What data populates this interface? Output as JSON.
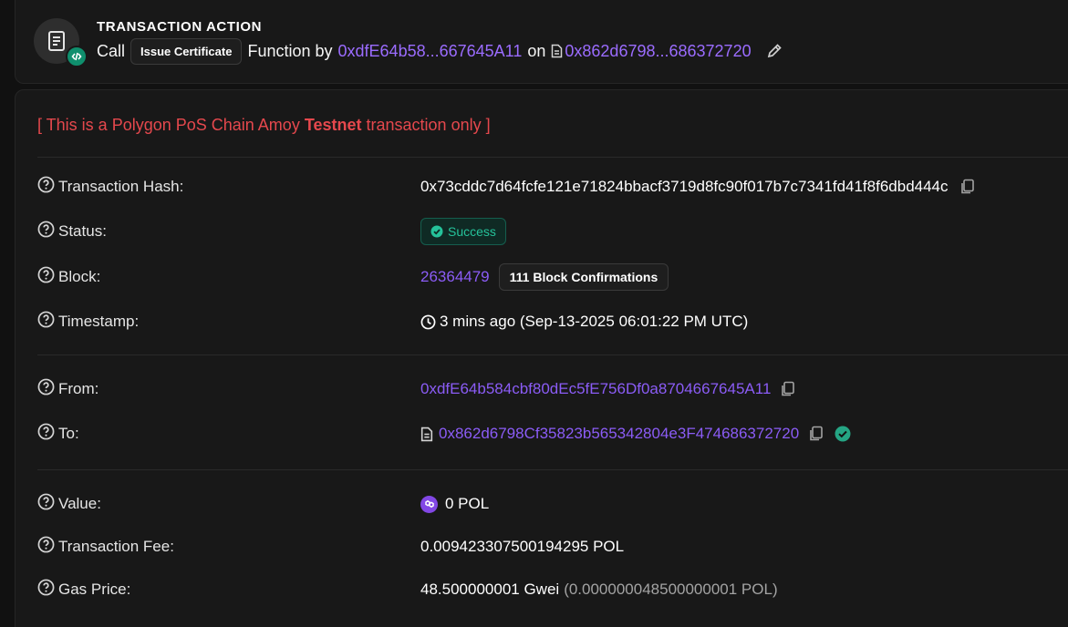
{
  "action": {
    "title": "TRANSACTION ACTION",
    "call": "Call",
    "method": "Issue Certificate",
    "function_by": "Function by",
    "from_short": "0xdfE64b58...667645A11",
    "on": "on",
    "contract_short": "0x862d6798...686372720"
  },
  "notice": {
    "prefix": "[ This is a Polygon PoS Chain Amoy ",
    "highlight": "Testnet",
    "suffix": " transaction only ]"
  },
  "rows": {
    "hash": {
      "label": "Transaction Hash:",
      "value": "0x73cddc7d64fcfe121e71824bbacf3719d8fc90f017b7c7341fd41f8f6dbd444c"
    },
    "status": {
      "label": "Status:",
      "value": "Success"
    },
    "block": {
      "label": "Block:",
      "number": "26364479",
      "confirmations": "111 Block Confirmations"
    },
    "timestamp": {
      "label": "Timestamp:",
      "value": "3 mins ago (Sep-13-2025 06:01:22 PM UTC)"
    },
    "from": {
      "label": "From:",
      "value": "0xdfE64b584cbf80dEc5fE756Df0a8704667645A11"
    },
    "to": {
      "label": "To:",
      "value": "0x862d6798Cf35823b565342804e3F474686372720"
    },
    "value": {
      "label": "Value:",
      "value": "0 POL"
    },
    "fee": {
      "label": "Transaction Fee:",
      "value": "0.00942330750019429​5 POL"
    },
    "gas": {
      "label": "Gas Price:",
      "value": "48.500000001 Gwei",
      "extra": "(0.000000048500000001 POL)"
    }
  },
  "colors": {
    "link": "#8b5cf6",
    "success": "#25c29a",
    "testnet": "#e5484d",
    "polygon": "#8247e5"
  }
}
